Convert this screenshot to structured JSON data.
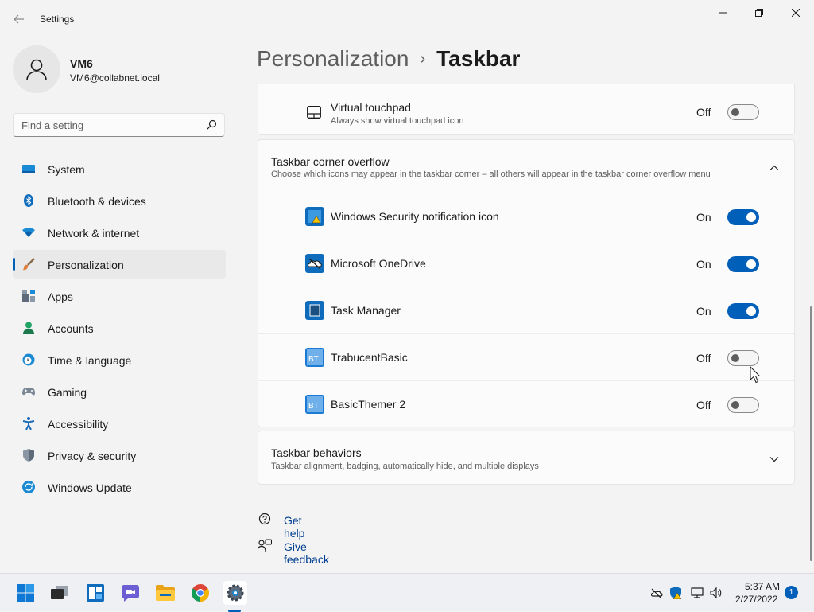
{
  "window": {
    "app_title": "Settings",
    "back_icon": "back-arrow-icon",
    "min_icon": "minimize-icon",
    "max_icon": "restore-icon",
    "close_icon": "close-icon"
  },
  "user": {
    "name": "VM6",
    "email": "VM6@collabnet.local"
  },
  "search": {
    "placeholder": "Find a setting"
  },
  "sidebar": {
    "items": [
      {
        "label": "System",
        "icon": "system-icon"
      },
      {
        "label": "Bluetooth & devices",
        "icon": "bluetooth-icon"
      },
      {
        "label": "Network & internet",
        "icon": "wifi-icon"
      },
      {
        "label": "Personalization",
        "icon": "brush-icon",
        "active": true
      },
      {
        "label": "Apps",
        "icon": "apps-icon"
      },
      {
        "label": "Accounts",
        "icon": "accounts-icon"
      },
      {
        "label": "Time & language",
        "icon": "clock-globe-icon"
      },
      {
        "label": "Gaming",
        "icon": "gamepad-icon"
      },
      {
        "label": "Accessibility",
        "icon": "accessibility-icon"
      },
      {
        "label": "Privacy & security",
        "icon": "shield-icon"
      },
      {
        "label": "Windows Update",
        "icon": "update-icon"
      }
    ]
  },
  "breadcrumb": {
    "parent": "Personalization",
    "separator": "›",
    "current": "Taskbar"
  },
  "touchpad": {
    "title": "Virtual touchpad",
    "subtitle": "Always show virtual touchpad icon",
    "state": "Off"
  },
  "overflow": {
    "title": "Taskbar corner overflow",
    "subtitle": "Choose which icons may appear in the taskbar corner – all others will appear in the taskbar corner overflow menu",
    "items": [
      {
        "label": "Windows Security notification icon",
        "state": "On",
        "icon": "windows-security-icon"
      },
      {
        "label": "Microsoft OneDrive",
        "state": "On",
        "icon": "onedrive-icon"
      },
      {
        "label": "Task Manager",
        "state": "On",
        "icon": "task-manager-icon"
      },
      {
        "label": "TrabucentBasic",
        "state": "Off",
        "icon": "bt-app-icon",
        "icon_text": "BT"
      },
      {
        "label": "BasicThemer 2",
        "state": "Off",
        "icon": "bt-app-icon",
        "icon_text": "BT"
      }
    ]
  },
  "behaviors": {
    "title": "Taskbar behaviors",
    "subtitle": "Taskbar alignment, badging, automatically hide, and multiple displays"
  },
  "links": {
    "help": "Get help",
    "feedback": "Give feedback"
  },
  "taskbar": {
    "time": "5:37 AM",
    "date": "2/27/2022",
    "notification_count": "1",
    "apps": [
      "start-icon",
      "task-view-icon",
      "widgets-icon",
      "chat-icon",
      "file-explorer-icon",
      "chrome-icon",
      "settings-icon"
    ]
  },
  "colors": {
    "accent": "#005fb8",
    "link": "#003e92",
    "background": "#f3f3f3",
    "card": "#fbfbfb"
  }
}
